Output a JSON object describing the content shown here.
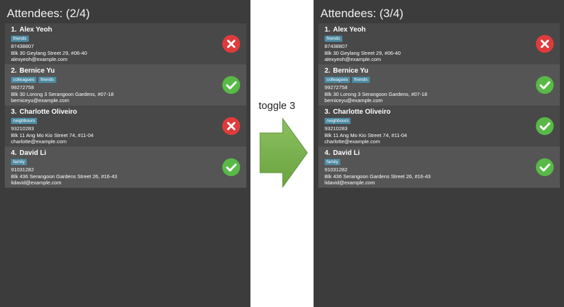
{
  "colors": {
    "panel_bg": "#3c3c3c",
    "card_odd_bg": "#484848",
    "card_even_bg": "#555555",
    "tag_bg": "#4d8aa3",
    "present": "#58b947",
    "absent": "#e03b3b",
    "arrow": "#79b04e"
  },
  "before": {
    "title": "Attendees: (2/4)",
    "persons": [
      {
        "index": "1.",
        "name": "Alex Yeoh",
        "tags": [
          "friends"
        ],
        "phone": "87438807",
        "address": "Blk 30 Geylang Street 29, #06-40",
        "email": "alexyeoh@example.com",
        "status": "absent",
        "icon": "cross-icon"
      },
      {
        "index": "2.",
        "name": "Bernice Yu",
        "tags": [
          "colleagues",
          "friends"
        ],
        "phone": "99272758",
        "address": "Blk 30 Lorong 3 Serangoon Gardens, #07-18",
        "email": "berniceyu@example.com",
        "status": "present",
        "icon": "check-icon"
      },
      {
        "index": "3.",
        "name": "Charlotte Oliveiro",
        "tags": [
          "neighbours"
        ],
        "phone": "93210283",
        "address": "Blk 11 Ang Mo Kio Street 74, #11-04",
        "email": "charlotte@example.com",
        "status": "absent",
        "icon": "cross-icon"
      },
      {
        "index": "4.",
        "name": "David Li",
        "tags": [
          "family"
        ],
        "phone": "91031282",
        "address": "Blk 436 Serangoon Gardens Street 26, #16-43",
        "email": "lidavid@example.com",
        "status": "present",
        "icon": "check-icon"
      }
    ]
  },
  "transition": {
    "label": "toggle 3",
    "icon": "right-arrow-icon"
  },
  "after": {
    "title": "Attendees: (3/4)",
    "persons": [
      {
        "index": "1.",
        "name": "Alex Yeoh",
        "tags": [
          "friends"
        ],
        "phone": "87438807",
        "address": "Blk 30 Geylang Street 29, #06-40",
        "email": "alexyeoh@example.com",
        "status": "absent",
        "icon": "cross-icon"
      },
      {
        "index": "2.",
        "name": "Bernice Yu",
        "tags": [
          "colleagues",
          "friends"
        ],
        "phone": "99272758",
        "address": "Blk 30 Lorong 3 Serangoon Gardens, #07-18",
        "email": "berniceyu@example.com",
        "status": "present",
        "icon": "check-icon"
      },
      {
        "index": "3.",
        "name": "Charlotte Oliveiro",
        "tags": [
          "neighbours"
        ],
        "phone": "93210283",
        "address": "Blk 11 Ang Mo Kio Street 74, #11-04",
        "email": "charlotte@example.com",
        "status": "present",
        "icon": "check-icon"
      },
      {
        "index": "4.",
        "name": "David Li",
        "tags": [
          "family"
        ],
        "phone": "91031282",
        "address": "Blk 436 Serangoon Gardens Street 26, #16-43",
        "email": "lidavid@example.com",
        "status": "present",
        "icon": "check-icon"
      }
    ]
  }
}
